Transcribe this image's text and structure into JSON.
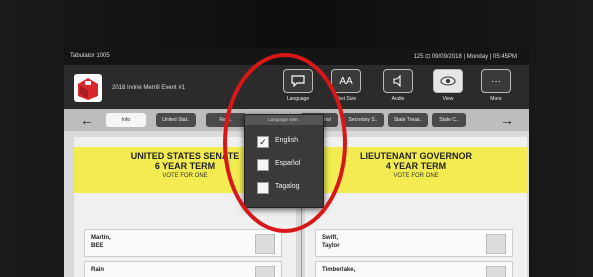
{
  "status": {
    "left": "Tabulator 1005",
    "right": "125 ⊡ 09/09/2018 | Monday | 05:45PM"
  },
  "header": {
    "election_name": "2018 Irvine Merrill Event #1"
  },
  "toolbar": {
    "language": "Language",
    "text_size": "Text Size",
    "audio": "Audio",
    "view": "View",
    "more": "More",
    "text_size_glyph": "AA",
    "more_glyph": "···"
  },
  "contest_tabs": [
    "Info",
    "United Stat..",
    "Repr..",
    "..ernatorial",
    "Secretary S..",
    "State Treas..",
    "State C.."
  ],
  "language_menu": {
    "title": "Language sele..",
    "options": [
      {
        "label": "English",
        "checked": true
      },
      {
        "label": "Español",
        "checked": false
      },
      {
        "label": "Tagalog",
        "checked": false
      }
    ]
  },
  "contests": [
    {
      "title_line1": "UNITED STATES SENATE",
      "title_line2": "6 YEAR TERM",
      "vote_for": "VOTE FOR ONE",
      "candidates": [
        {
          "name": "Martin,",
          "party": "BEE"
        },
        {
          "name": "Rain",
          "party": ""
        }
      ]
    },
    {
      "title_line1": "LIEUTENANT GOVERNOR",
      "title_line2": "4 YEAR TERM",
      "vote_for": "VOTE FOR ONE",
      "candidates": [
        {
          "name": "Swift,",
          "party": "Taylor"
        },
        {
          "name": "Timberlake,",
          "party": ""
        }
      ]
    }
  ],
  "colors": {
    "highlight_circle": "#d81818",
    "contest_header": "#f2ec52"
  }
}
